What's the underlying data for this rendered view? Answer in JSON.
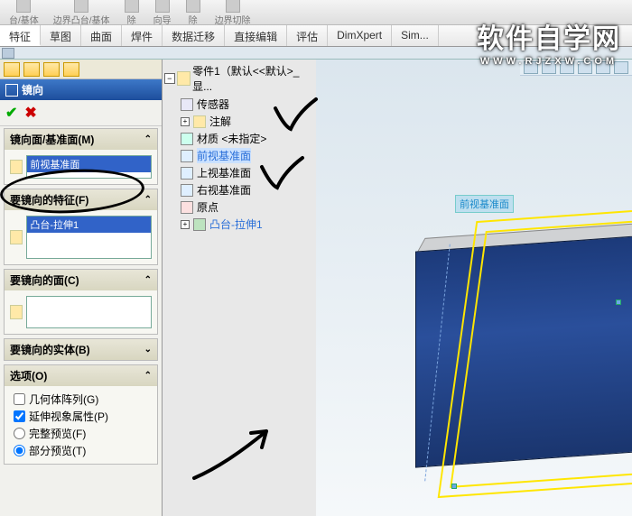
{
  "top_commands": {
    "cmd1": "台/基体",
    "cmd2": "边界凸台/基体",
    "cmd3": "除",
    "cmd4": "向导",
    "cmd5": "除",
    "cmd6": "边界切除"
  },
  "ribbon": {
    "tabs": [
      "特征",
      "草图",
      "曲面",
      "焊件",
      "数据迁移",
      "直接编辑",
      "评估",
      "DimXpert",
      "Sim..."
    ]
  },
  "pm": {
    "title": "镜向",
    "sections": {
      "mirror_plane": {
        "header": "镜向面/基准面(M)",
        "value": "前视基准面"
      },
      "features": {
        "header": "要镜向的特征(F)",
        "selected": "凸台-拉伸1"
      },
      "faces": {
        "header": "要镜向的面(C)"
      },
      "bodies": {
        "header": "要镜向的实体(B)"
      },
      "options": {
        "header": "选项(O)",
        "geom_pattern": "几何体阵列(G)",
        "propagate": "延伸视象属性(P)",
        "full_preview": "完整预览(F)",
        "partial_preview": "部分预览(T)"
      }
    }
  },
  "tree": {
    "root": "零件1（默认<<默认>_显...",
    "sensors": "传感器",
    "annotations": "注解",
    "material": "材质 <未指定>",
    "front_plane": "前视基准面",
    "top_plane": "上视基准面",
    "right_plane": "右视基准面",
    "origin": "原点",
    "feature1": "凸台-拉伸1"
  },
  "viewport": {
    "selected_plane_label": "前视基准面"
  },
  "watermark": {
    "main": "软件自学网",
    "sub": "WWW.RJZXW.COM"
  }
}
